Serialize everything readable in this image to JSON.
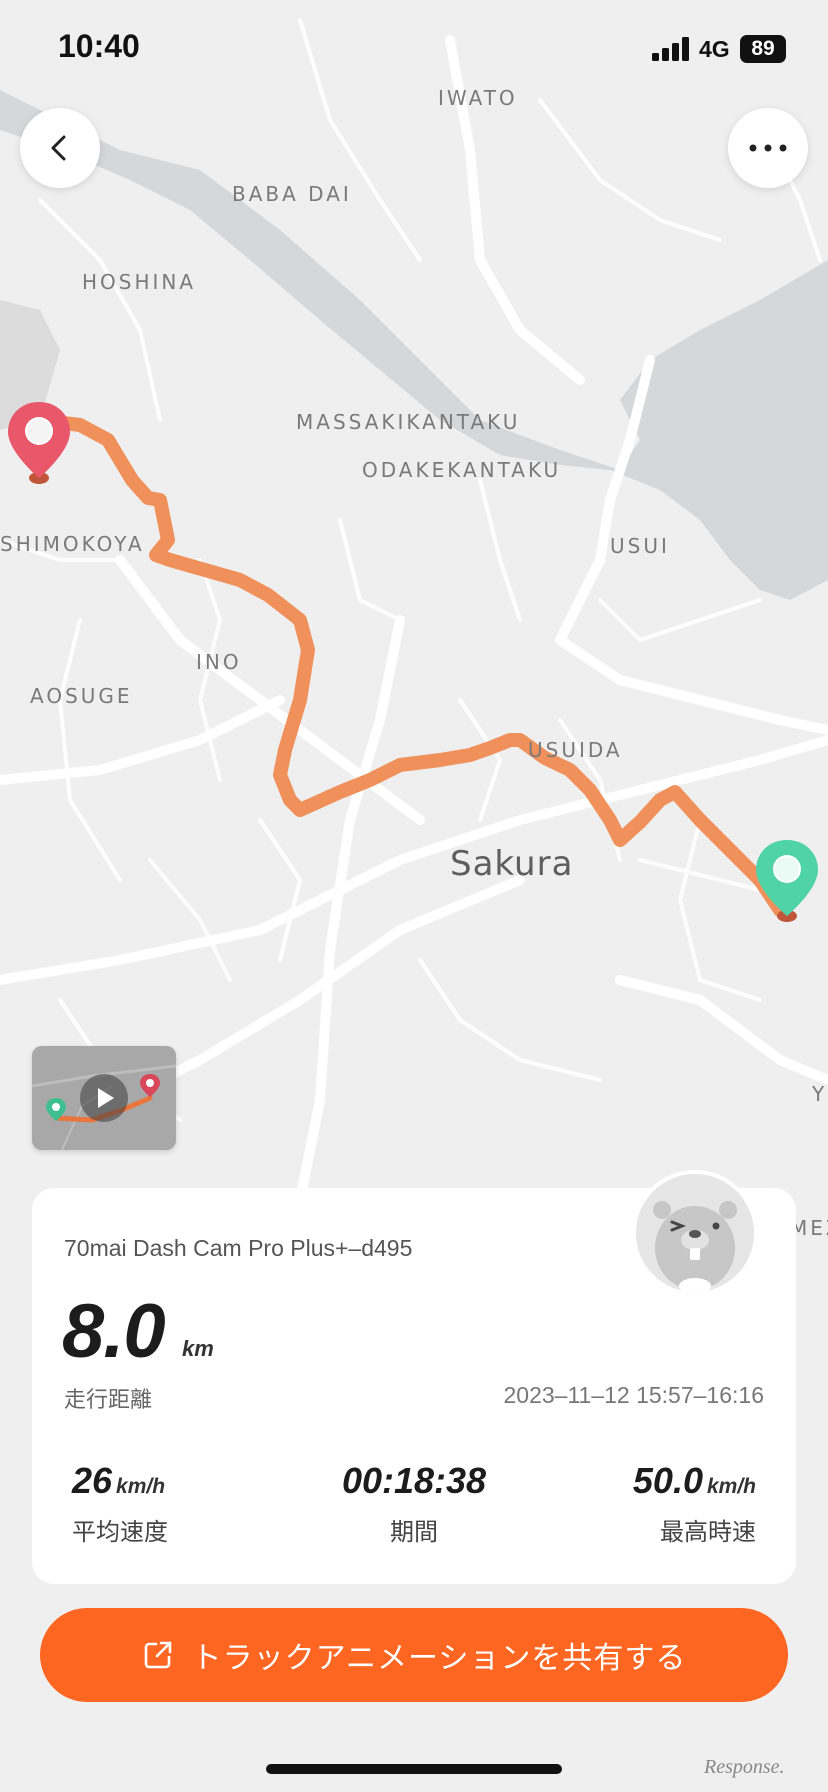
{
  "status_bar": {
    "time": "10:40",
    "network": "4G",
    "battery": "89"
  },
  "map": {
    "labels": {
      "iwato": "IWATO",
      "baba_dai": "BABA DAI",
      "hoshina": "HOSHINA",
      "massakikantaku": "MASSAKIKANTAKU",
      "odakekantaku": "ODAKEKANTAKU",
      "usui": "USUI",
      "shimokoya": "SHIMOKOYA",
      "ino": "INO",
      "aosuge": "AOSUGE",
      "usuida": "USUIDA",
      "sakura": "Sakura",
      "edge_y": "Y",
      "edge_mez": "MEZ"
    },
    "colors": {
      "route": "#f0905a",
      "start_pin": "#e8586a",
      "end_pin": "#4fd3a7"
    }
  },
  "trip": {
    "device_name": "70mai Dash Cam Pro Plus+–d495",
    "distance": "8.0",
    "distance_unit": "km",
    "distance_label": "走行距離",
    "date_range": "2023–11–12 15:57–16:16",
    "avg_speed": {
      "value": "26",
      "unit": "km/h",
      "label": "平均速度"
    },
    "duration": {
      "value": "00:18:38",
      "label": "期間"
    },
    "max_speed": {
      "value": "50.0",
      "unit": "km/h",
      "label": "最高時速"
    }
  },
  "share": {
    "label": "トラックアニメーションを共有する",
    "color": "#ff6622"
  },
  "watermark": "Response."
}
